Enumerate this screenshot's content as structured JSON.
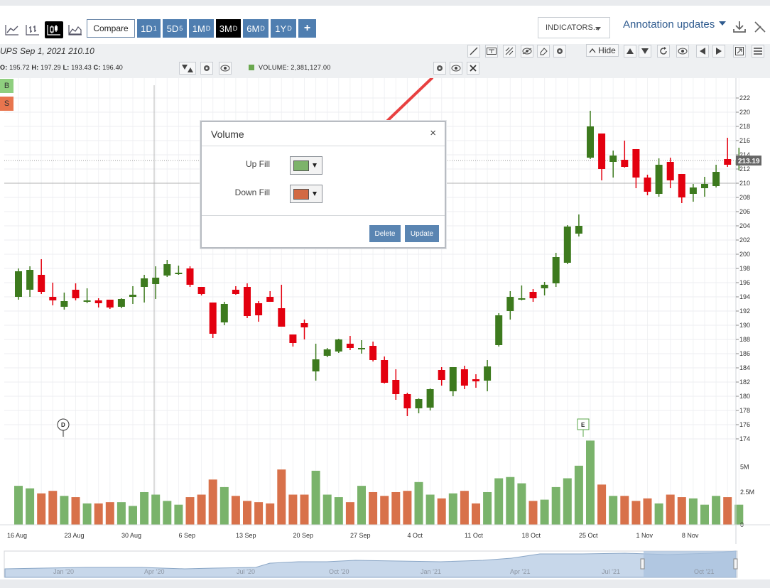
{
  "toolbar": {
    "compare_label": "Compare",
    "periods": [
      {
        "label": "1D",
        "sub": "1",
        "active": false
      },
      {
        "label": "5D",
        "sub": "5",
        "active": false
      },
      {
        "label": "1M",
        "sub": "D",
        "active": false
      },
      {
        "label": "3M",
        "sub": "D",
        "active": true
      },
      {
        "label": "6M",
        "sub": "D",
        "active": false
      },
      {
        "label": "1Y",
        "sub": "D",
        "active": false
      }
    ],
    "plus_label": "+",
    "indicators_label": "INDICATORS...",
    "annotation_label": "Annotation updates"
  },
  "info": {
    "ticker_line": "UPS  Sep 1, 2021 210.10",
    "ohlc_o": "195.72",
    "ohlc_h": "197.29",
    "ohlc_l": "193.43",
    "ohlc_c": "196.40",
    "hide_label": "Hide",
    "volume_label": "VOLUME: 2,381,127.00"
  },
  "side_buttons": {
    "buy": "B",
    "sell": "S"
  },
  "colors": {
    "up": "#3d7a1e",
    "down": "#e3000f",
    "vol_up": "#7ab36b",
    "vol_down": "#d8714a",
    "accent": "#4f7eb0",
    "arrow": "#e84040"
  },
  "dialog": {
    "title": "Volume",
    "close": "×",
    "up_fill_label": "Up Fill",
    "down_fill_label": "Down Fill",
    "up_fill_color": "#7db36a",
    "down_fill_color": "#d26a43",
    "delete_label": "Delete",
    "update_label": "Update"
  },
  "chart_data": {
    "type": "candlestick",
    "ylim": [
      170,
      223
    ],
    "price_ticks": [
      "222",
      "220",
      "218",
      "216",
      "214",
      "212",
      "210",
      "208",
      "206",
      "204",
      "202",
      "200",
      "198",
      "196",
      "194",
      "192",
      "190",
      "188",
      "186",
      "184",
      "182",
      "180",
      "178",
      "176",
      "174"
    ],
    "current_price": "213.19",
    "volume_ticks": [
      "5M",
      "2.5M",
      "0"
    ],
    "date_labels": [
      "16 Aug",
      "23 Aug",
      "30 Aug",
      "6 Sep",
      "13 Sep",
      "20 Sep",
      "27 Sep",
      "4 Oct",
      "11 Oct",
      "18 Oct",
      "25 Oct",
      "1 Nov",
      "8 Nov"
    ],
    "markers": [
      {
        "label": "D"
      },
      {
        "label": "E"
      }
    ],
    "candles": [
      {
        "o": 194,
        "h": 198,
        "l": 193.6,
        "c": 197.6
      },
      {
        "o": 195,
        "h": 198.3,
        "l": 194,
        "c": 197.8
      },
      {
        "o": 197.1,
        "h": 199.3,
        "l": 194.4,
        "c": 194.7
      },
      {
        "o": 194,
        "h": 196,
        "l": 192.8,
        "c": 193.5
      },
      {
        "o": 192.6,
        "h": 194.6,
        "l": 192.2,
        "c": 193.4
      },
      {
        "o": 195,
        "h": 195.9,
        "l": 193.5,
        "c": 193.8
      },
      {
        "o": 193.4,
        "h": 195.2,
        "l": 193.1,
        "c": 193.5
      },
      {
        "o": 193.5,
        "h": 193.8,
        "l": 192.5,
        "c": 193.1
      },
      {
        "o": 193.6,
        "h": 193.6,
        "l": 192.3,
        "c": 192.5
      },
      {
        "o": 192.6,
        "h": 193.8,
        "l": 192.4,
        "c": 193.7
      },
      {
        "o": 194,
        "h": 195.5,
        "l": 193,
        "c": 194.3
      },
      {
        "o": 195.4,
        "h": 197.1,
        "l": 193.2,
        "c": 196.6
      },
      {
        "o": 195.8,
        "h": 198.3,
        "l": 193.7,
        "c": 196.7
      },
      {
        "o": 197,
        "h": 199.2,
        "l": 196.8,
        "c": 198.6
      },
      {
        "o": 197.3,
        "h": 198.4,
        "l": 197.1,
        "c": 197.4
      },
      {
        "o": 198,
        "h": 198.3,
        "l": 195.4,
        "c": 195.7
      },
      {
        "o": 195.4,
        "h": 195.4,
        "l": 194.2,
        "c": 194.4
      },
      {
        "o": 193.2,
        "h": 193.2,
        "l": 188.2,
        "c": 188.8
      },
      {
        "o": 190.4,
        "h": 193.3,
        "l": 190,
        "c": 193
      },
      {
        "o": 195,
        "h": 195.5,
        "l": 194.3,
        "c": 194.4
      },
      {
        "o": 195.4,
        "h": 195.9,
        "l": 191,
        "c": 191.3
      },
      {
        "o": 193.1,
        "h": 193.4,
        "l": 190.5,
        "c": 191.4
      },
      {
        "o": 194,
        "h": 194.8,
        "l": 193.3,
        "c": 193.3
      },
      {
        "o": 192.4,
        "h": 195.7,
        "l": 190,
        "c": 189.8
      },
      {
        "o": 188.7,
        "h": 188.7,
        "l": 187,
        "c": 187.5
      },
      {
        "o": 190.3,
        "h": 190.8,
        "l": 188,
        "c": 189.7
      },
      {
        "o": 183.5,
        "h": 187.4,
        "l": 182.2,
        "c": 185.2
      },
      {
        "o": 185.7,
        "h": 186.8,
        "l": 185.5,
        "c": 186.6
      },
      {
        "o": 186.3,
        "h": 188.1,
        "l": 186.1,
        "c": 188
      },
      {
        "o": 187.4,
        "h": 188.5,
        "l": 186.5,
        "c": 186.8
      },
      {
        "o": 186.6,
        "h": 187.9,
        "l": 186,
        "c": 186.8
      },
      {
        "o": 187.1,
        "h": 187.7,
        "l": 184.9,
        "c": 185.1
      },
      {
        "o": 185.1,
        "h": 185.6,
        "l": 181.8,
        "c": 181.9
      },
      {
        "o": 182.3,
        "h": 183.8,
        "l": 179.5,
        "c": 180.3
      },
      {
        "o": 180.3,
        "h": 180.5,
        "l": 177.2,
        "c": 178.3
      },
      {
        "o": 178.3,
        "h": 179.7,
        "l": 177.6,
        "c": 179.6
      },
      {
        "o": 178.4,
        "h": 181.1,
        "l": 178,
        "c": 181
      },
      {
        "o": 183.7,
        "h": 184.1,
        "l": 181.5,
        "c": 182.3
      },
      {
        "o": 180.7,
        "h": 184,
        "l": 180,
        "c": 184.1
      },
      {
        "o": 183.8,
        "h": 184.3,
        "l": 181,
        "c": 181.5
      },
      {
        "o": 182.4,
        "h": 183.1,
        "l": 181.2,
        "c": 182.1
      },
      {
        "o": 182.2,
        "h": 185.1,
        "l": 180.7,
        "c": 184.2
      },
      {
        "o": 187.2,
        "h": 191.7,
        "l": 187,
        "c": 191.4
      },
      {
        "o": 192,
        "h": 194.8,
        "l": 190.8,
        "c": 194
      },
      {
        "o": 193.7,
        "h": 195.6,
        "l": 193.5,
        "c": 193.8
      },
      {
        "o": 194.7,
        "h": 195.1,
        "l": 193.3,
        "c": 193.8
      },
      {
        "o": 195.2,
        "h": 196.1,
        "l": 194.2,
        "c": 195.7
      },
      {
        "o": 195.9,
        "h": 200.2,
        "l": 195.4,
        "c": 199.6
      },
      {
        "o": 198.8,
        "h": 204.1,
        "l": 198.6,
        "c": 203.9
      },
      {
        "o": 202.9,
        "h": 205.6,
        "l": 202.5,
        "c": 204
      },
      {
        "o": 213.6,
        "h": 220.2,
        "l": 213.4,
        "c": 218
      },
      {
        "o": 217,
        "h": 217,
        "l": 210.4,
        "c": 212
      },
      {
        "o": 213,
        "h": 214.6,
        "l": 210.8,
        "c": 213.9
      },
      {
        "o": 213.3,
        "h": 216,
        "l": 212.2,
        "c": 212.3
      },
      {
        "o": 214.8,
        "h": 214.8,
        "l": 209.3,
        "c": 210.8
      },
      {
        "o": 210.8,
        "h": 211.2,
        "l": 208.3,
        "c": 208.8
      },
      {
        "o": 208.5,
        "h": 213.5,
        "l": 208.1,
        "c": 212.6
      },
      {
        "o": 213,
        "h": 213.6,
        "l": 209.3,
        "c": 210.4
      },
      {
        "o": 211.3,
        "h": 211.3,
        "l": 207.2,
        "c": 208
      },
      {
        "o": 208.5,
        "h": 209.9,
        "l": 207.4,
        "c": 209.4
      },
      {
        "o": 209.3,
        "h": 210.9,
        "l": 208.1,
        "c": 209.9
      },
      {
        "o": 209.6,
        "h": 212.6,
        "l": 209.4,
        "c": 211.6
      },
      {
        "o": 213.4,
        "h": 216.4,
        "l": 212.3,
        "c": 212.6
      },
      {
        "o": 212.6,
        "h": 215,
        "l": 211.8,
        "c": 213.2
      }
    ],
    "volumes_m": [
      3.1,
      2.9,
      2.5,
      2.7,
      2.3,
      2.2,
      1.7,
      1.7,
      1.8,
      1.8,
      1.5,
      2.6,
      2.4,
      1.9,
      1.6,
      2.2,
      2.4,
      3.6,
      3.0,
      2.3,
      1.9,
      1.8,
      1.7,
      4.4,
      2.4,
      2.4,
      4.3,
      2.4,
      2.2,
      1.8,
      3.1,
      2.6,
      2.3,
      2.6,
      2.7,
      3.4,
      2.4,
      2.1,
      2.5,
      2.7,
      1.7,
      2.6,
      3.7,
      3.8,
      3.3,
      1.9,
      2.0,
      3.0,
      3.7,
      4.7,
      6.7,
      3.2,
      2.3,
      2.3,
      1.9,
      2.1,
      1.7,
      2.4,
      2.2,
      2.1,
      1.6,
      2.3,
      2.2,
      1.6
    ]
  }
}
